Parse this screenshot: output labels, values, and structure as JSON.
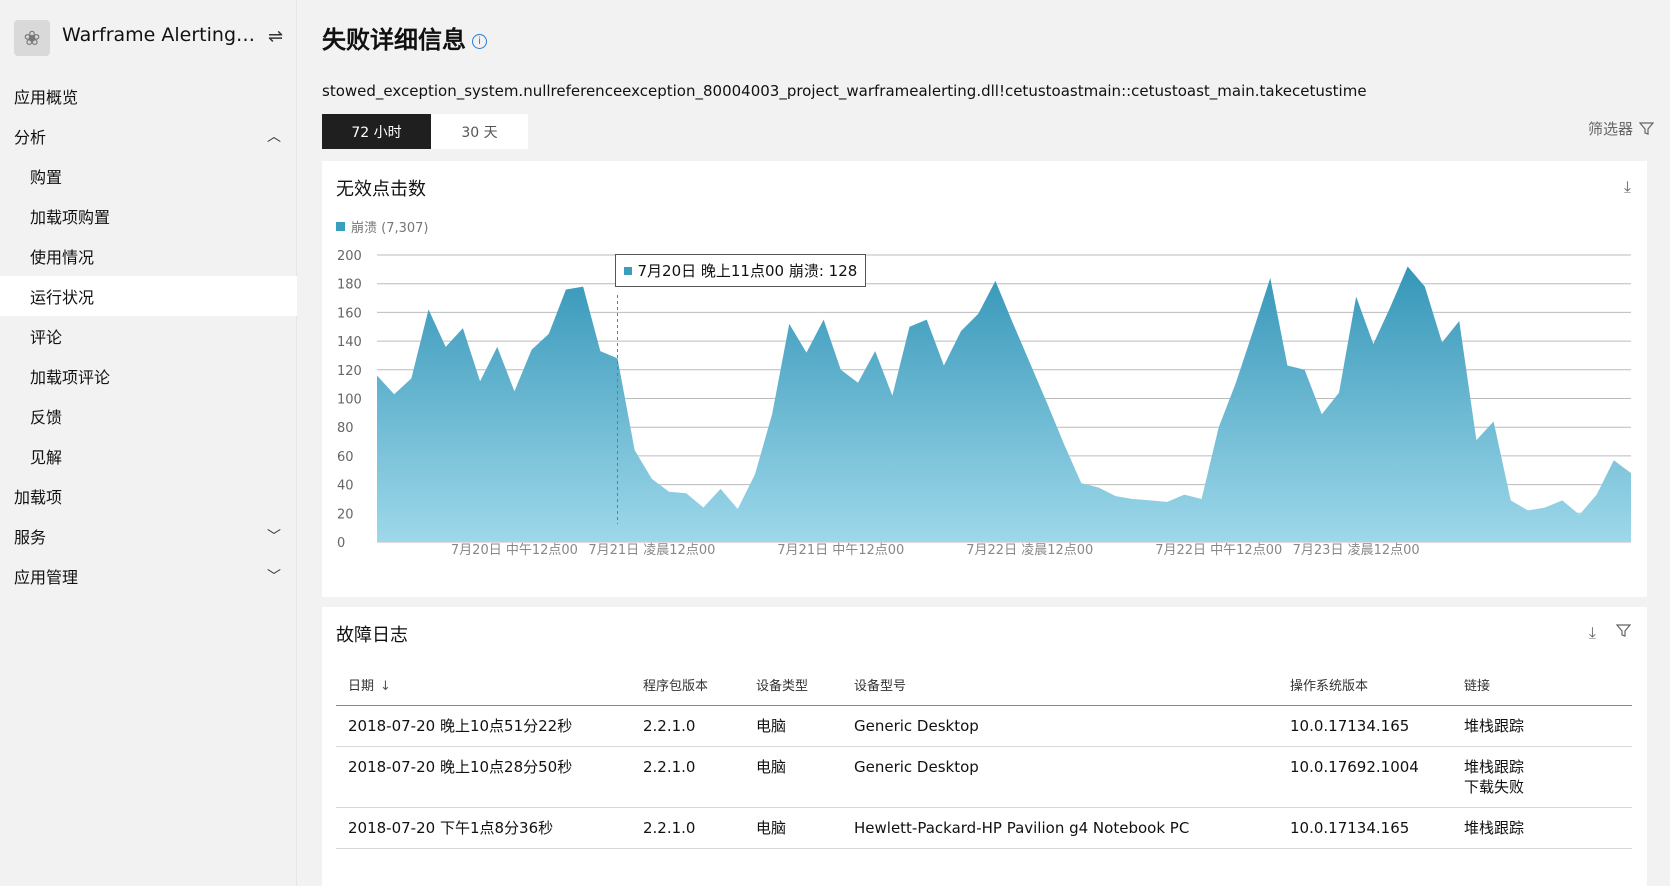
{
  "app": {
    "title": "Warframe Alerting P..."
  },
  "sidebar": {
    "items": [
      {
        "label": "应用概览",
        "level": 1
      },
      {
        "label": "分析",
        "level": 1,
        "expanded": true
      },
      {
        "label": "购置",
        "level": 2
      },
      {
        "label": "加载项购置",
        "level": 2
      },
      {
        "label": "使用情况",
        "level": 2
      },
      {
        "label": "运行状况",
        "level": 2,
        "active": true
      },
      {
        "label": "评论",
        "level": 2
      },
      {
        "label": "加载项评论",
        "level": 2
      },
      {
        "label": "反馈",
        "level": 2
      },
      {
        "label": "见解",
        "level": 2
      },
      {
        "label": "加载项",
        "level": 1
      },
      {
        "label": "服务",
        "level": 1,
        "expanded": false
      },
      {
        "label": "应用管理",
        "level": 1,
        "expanded": false
      }
    ]
  },
  "page": {
    "title": "失败详细信息",
    "exception": "stowed_exception_system.nullreferenceexception_80004003_project_warframealerting.dll!cetustoastmain::cetustoast_main.takecetustime",
    "tabs": [
      "72 小时",
      "30 天"
    ],
    "filter_label": "筛选器"
  },
  "chart": {
    "title": "无效点击数",
    "legend": "崩溃 (7,307)",
    "tooltip": "7月20日 晚上11点00 崩溃: 128",
    "color": "#3a9fbf"
  },
  "chart_data": {
    "type": "area",
    "title": "无效点击数",
    "series": [
      {
        "name": "崩溃 (7,307)",
        "values": [
          116,
          103,
          114,
          162,
          136,
          149,
          112,
          136,
          105,
          134,
          145,
          176,
          178,
          133,
          128,
          64,
          44,
          35,
          34,
          24,
          37,
          23,
          47,
          89,
          152,
          132,
          155,
          120,
          111,
          133,
          102,
          150,
          155,
          123,
          147,
          159,
          182,
          153,
          125,
          97,
          68,
          41,
          38,
          32,
          30,
          29,
          28,
          33,
          30,
          80,
          111,
          147,
          184,
          123,
          120,
          89,
          104,
          171,
          138,
          164,
          192,
          178,
          139,
          154,
          71,
          84,
          29,
          22,
          24,
          29,
          19,
          33,
          57,
          48
        ]
      }
    ],
    "x_tick_labels": [
      "7月20日 中午12点00",
      "7月21日 凌晨12点00",
      "7月21日 中午12点00",
      "7月22日 凌晨12点00",
      "7月22日 中午12点00",
      "7月23日 凌晨12点00"
    ],
    "x_tick_positions": [
      8,
      16,
      27,
      38,
      49,
      57
    ],
    "ylim": [
      0,
      200
    ],
    "y_ticks": [
      0,
      20,
      40,
      60,
      80,
      100,
      120,
      140,
      160,
      180,
      200
    ],
    "grid": true,
    "legend_position": "top-left",
    "highlight_index": 14
  },
  "log": {
    "title": "故障日志",
    "columns": [
      "日期",
      "程序包版本",
      "设备类型",
      "设备型号",
      "操作系统版本",
      "链接"
    ],
    "rows": [
      {
        "date": "2018-07-20 晚上10点51分22秒",
        "pkg": "2.2.1.0",
        "type": "电脑",
        "model": "Generic Desktop",
        "os": "10.0.17134.165",
        "links": [
          "堆栈跟踪"
        ]
      },
      {
        "date": "2018-07-20 晚上10点28分50秒",
        "pkg": "2.2.1.0",
        "type": "电脑",
        "model": "Generic Desktop",
        "os": "10.0.17692.1004",
        "links": [
          "堆栈跟踪",
          "下载失败"
        ]
      },
      {
        "date": "2018-07-20 下午1点8分36秒",
        "pkg": "2.2.1.0",
        "type": "电脑",
        "model": "Hewlett-Packard-HP Pavilion g4 Notebook PC",
        "os": "10.0.17134.165",
        "links": [
          "堆栈跟踪"
        ]
      }
    ]
  }
}
